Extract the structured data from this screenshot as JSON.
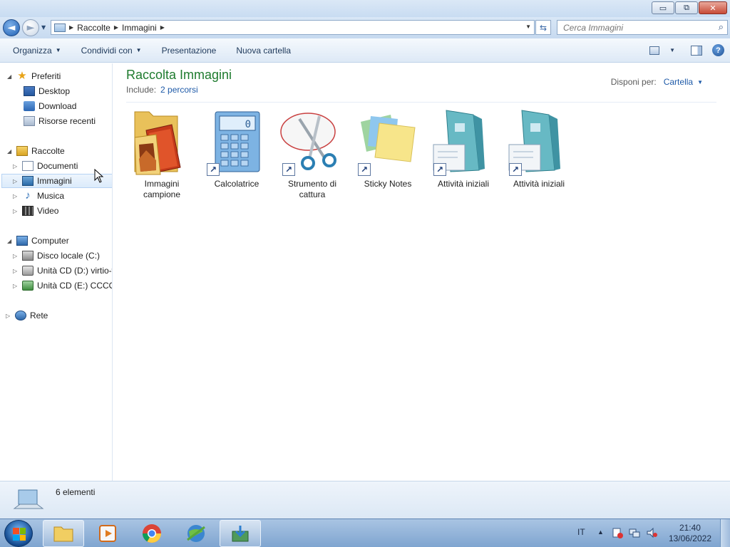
{
  "window": {
    "buttons": {
      "minimize": "▭",
      "maximize": "⧉",
      "close": "✕"
    }
  },
  "address": {
    "crumbs": [
      "Raccolte",
      "Immagini"
    ],
    "search_placeholder": "Cerca Immagini"
  },
  "commandbar": {
    "organize": "Organizza",
    "share": "Condividi con",
    "slideshow": "Presentazione",
    "new_folder": "Nuova cartella"
  },
  "nav": {
    "favorites": "Preferiti",
    "desktop": "Desktop",
    "download": "Download",
    "recent": "Risorse recenti",
    "libraries": "Raccolte",
    "documents": "Documenti",
    "pictures": "Immagini",
    "music": "Musica",
    "video": "Video",
    "computer": "Computer",
    "drive_c": "Disco locale (C:)",
    "drive_d": "Unità CD (D:) virtio-w",
    "drive_e": "Unità CD (E:) CCCOM",
    "network": "Rete"
  },
  "library": {
    "title": "Raccolta Immagini",
    "includes_label": "Include:",
    "includes_link": "2 percorsi",
    "arrange_label": "Disponi per:",
    "arrange_value": "Cartella"
  },
  "items": [
    {
      "line1": "Immagini",
      "line2": "campione",
      "icon": "pictures-folder-icon"
    },
    {
      "line1": "Calcolatrice",
      "line2": "",
      "icon": "calculator-icon"
    },
    {
      "line1": "Strumento di",
      "line2": "cattura",
      "icon": "snipping-tool-icon"
    },
    {
      "line1": "Sticky Notes",
      "line2": "",
      "icon": "sticky-notes-icon"
    },
    {
      "line1": "Attività iniziali",
      "line2": "",
      "icon": "getting-started-icon"
    },
    {
      "line1": "Attività iniziali",
      "line2": "",
      "icon": "getting-started-icon"
    }
  ],
  "status": {
    "count": "6 elementi"
  },
  "taskbar": {
    "language": "IT",
    "time": "21:40",
    "date": "13/06/2022"
  },
  "colors": {
    "title_green": "#1e7b2e",
    "link_blue": "#1e5aa8",
    "taskbar": "#8fb1d8"
  }
}
